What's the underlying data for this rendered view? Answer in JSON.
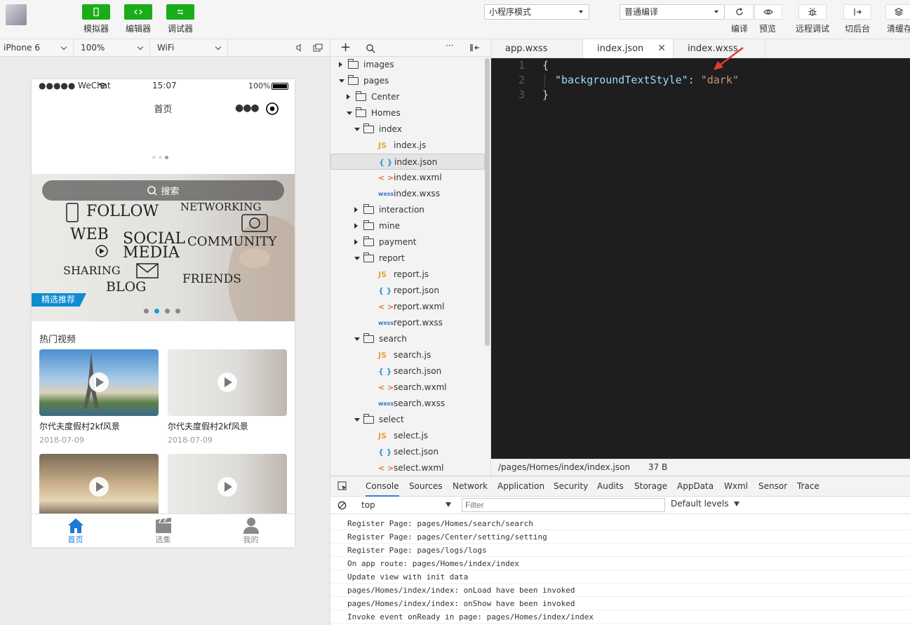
{
  "toolbar": {
    "simulator_label": "模拟器",
    "editor_label": "编辑器",
    "debugger_label": "调试器",
    "mode_select": "小程序模式",
    "compile_select": "普通编译",
    "compile_label": "编译",
    "preview_label": "预览",
    "remote_debug_label": "远程调试",
    "background_label": "切后台",
    "clear_cache_label": "清缓存"
  },
  "simulator": {
    "device": "iPhone 6",
    "zoom": "100%",
    "network": "WiFi",
    "status": {
      "carrier": "●●●●● WeChat",
      "time": "15:07",
      "battery": "100%"
    },
    "nav_title": "首页",
    "search_label": "搜索",
    "banner_tag": "精选推荐",
    "banner_words": [
      "FOLLOW",
      "NETWORKING",
      "WEB",
      "SOCIAL",
      "MEDIA",
      "COMMUNITY",
      "SHARING",
      "BLOG",
      "FRIENDS"
    ],
    "section_title": "热门视频",
    "videos": [
      {
        "title": "尔代夫度假村2kf风景",
        "date": "2018-07-09"
      },
      {
        "title": "尔代夫度假村2kf风景",
        "date": "2018-07-09"
      }
    ],
    "tabbar": [
      {
        "label": "首页",
        "icon": "home-icon"
      },
      {
        "label": "选集",
        "icon": "clapperboard-icon"
      },
      {
        "label": "我的",
        "icon": "user-icon"
      }
    ]
  },
  "filetree": {
    "items": [
      {
        "name": "images",
        "type": "folder",
        "depth": 0,
        "open": false
      },
      {
        "name": "pages",
        "type": "folder",
        "depth": 0,
        "open": true
      },
      {
        "name": "Center",
        "type": "folder",
        "depth": 1,
        "open": false
      },
      {
        "name": "Homes",
        "type": "folder",
        "depth": 1,
        "open": true
      },
      {
        "name": "index",
        "type": "folder",
        "depth": 2,
        "open": true
      },
      {
        "name": "index.js",
        "type": "js",
        "depth": 3
      },
      {
        "name": "index.json",
        "type": "json",
        "depth": 3,
        "selected": true
      },
      {
        "name": "index.wxml",
        "type": "wxml",
        "depth": 3
      },
      {
        "name": "index.wxss",
        "type": "wxss",
        "depth": 3
      },
      {
        "name": "interaction",
        "type": "folder",
        "depth": 2,
        "open": false
      },
      {
        "name": "mine",
        "type": "folder",
        "depth": 2,
        "open": false
      },
      {
        "name": "payment",
        "type": "folder",
        "depth": 2,
        "open": false
      },
      {
        "name": "report",
        "type": "folder",
        "depth": 2,
        "open": true
      },
      {
        "name": "report.js",
        "type": "js",
        "depth": 3
      },
      {
        "name": "report.json",
        "type": "json",
        "depth": 3
      },
      {
        "name": "report.wxml",
        "type": "wxml",
        "depth": 3
      },
      {
        "name": "report.wxss",
        "type": "wxss",
        "depth": 3
      },
      {
        "name": "search",
        "type": "folder",
        "depth": 2,
        "open": true
      },
      {
        "name": "search.js",
        "type": "js",
        "depth": 3
      },
      {
        "name": "search.json",
        "type": "json",
        "depth": 3
      },
      {
        "name": "search.wxml",
        "type": "wxml",
        "depth": 3
      },
      {
        "name": "search.wxss",
        "type": "wxss",
        "depth": 3
      },
      {
        "name": "select",
        "type": "folder",
        "depth": 2,
        "open": true
      },
      {
        "name": "select.js",
        "type": "js",
        "depth": 3
      },
      {
        "name": "select.json",
        "type": "json",
        "depth": 3
      },
      {
        "name": "select.wxml",
        "type": "wxml",
        "depth": 3
      }
    ],
    "icon_text": {
      "js": "JS",
      "json": "{ }",
      "wxml": "< >",
      "wxss": "wxss"
    }
  },
  "editor": {
    "tabs": [
      {
        "label": "app.wxss",
        "active": false
      },
      {
        "label": "index.json",
        "active": true
      },
      {
        "label": "index.wxss",
        "active": false
      }
    ],
    "lines": [
      "1",
      "2",
      "3"
    ],
    "code": {
      "open": "{",
      "key": "\"backgroundTextStyle\"",
      "colon": ": ",
      "value": "\"dark\"",
      "close": "}"
    },
    "status_path": "/pages/Homes/index/index.json",
    "status_size": "37 B"
  },
  "devtools": {
    "tabs": [
      "Console",
      "Sources",
      "Network",
      "Application",
      "Security",
      "Audits",
      "Storage",
      "AppData",
      "Wxml",
      "Sensor",
      "Trace"
    ],
    "context": "top",
    "filter_placeholder": "Filter",
    "levels": "Default levels",
    "logs": [
      "Register Page: pages/Homes/search/search",
      "Register Page: pages/Center/setting/setting",
      "Register Page: pages/logs/logs",
      "On app route: pages/Homes/index/index",
      "Update view with init data",
      "pages/Homes/index/index: onLoad have been invoked",
      "pages/Homes/index/index: onShow have been invoked",
      "Invoke event onReady in page: pages/Homes/index/index"
    ]
  },
  "colors": {
    "accent_green": "#1aad19",
    "active_blue": "#1a7ad4",
    "editor_bg": "#1e1e1e",
    "banner_tag": "#0e8bd2",
    "arrow_red": "#e53935"
  }
}
